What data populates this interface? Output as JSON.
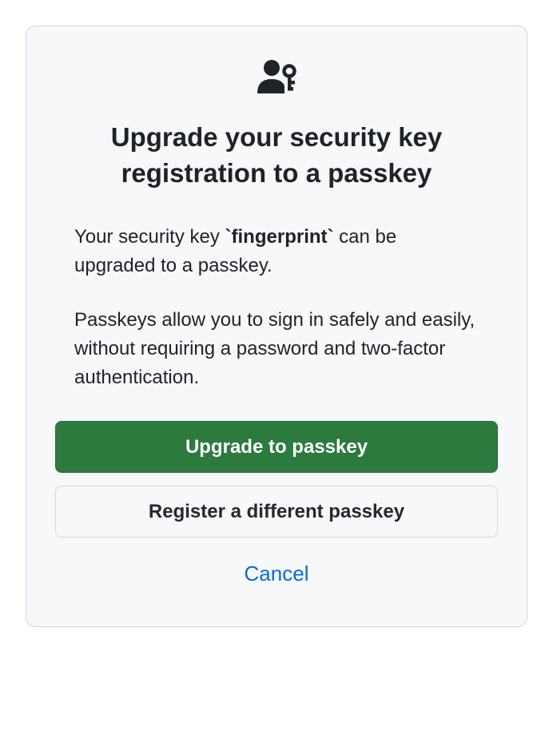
{
  "dialog": {
    "title": "Upgrade your security key registration to a passkey",
    "body": {
      "line1_prefix": "Your security key ",
      "key_name": "`fingerprint`",
      "line1_suffix": " can be upgraded to a passkey.",
      "line2": "Passkeys allow you to sign in safely and easily, without requiring a password and two-factor authentication."
    },
    "actions": {
      "primary_label": "Upgrade to passkey",
      "secondary_label": "Register a different passkey",
      "cancel_label": "Cancel"
    }
  }
}
